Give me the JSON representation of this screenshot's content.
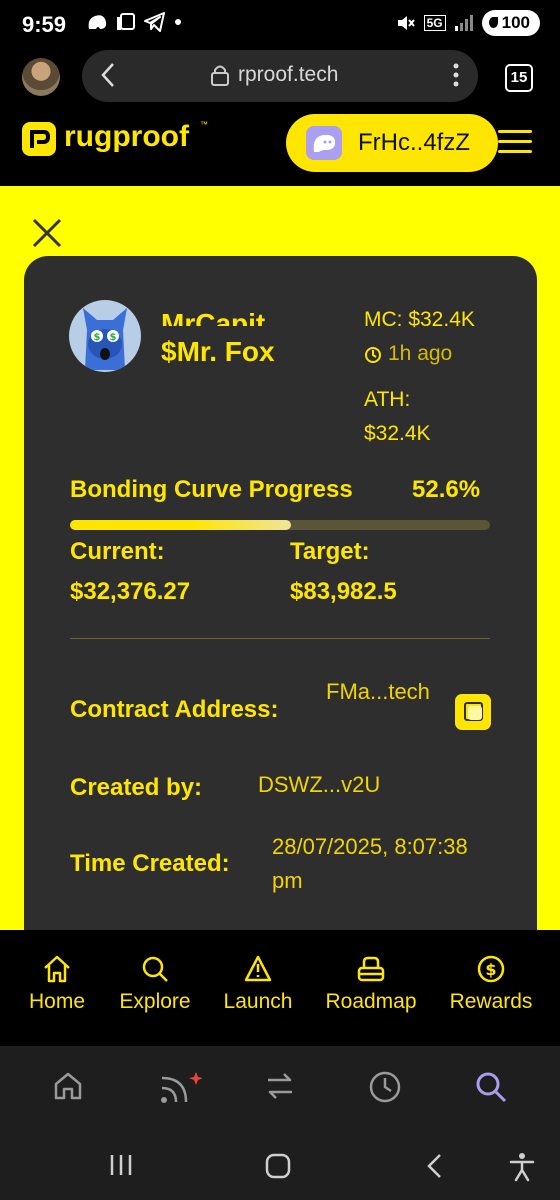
{
  "status_bar": {
    "time": "9:59",
    "network": "5G",
    "battery": "100"
  },
  "browser": {
    "url": "rproof.tech",
    "tab_count": "15"
  },
  "site_header": {
    "logo_text": "rugproof",
    "logo_tm": "™",
    "wallet_address": "FrHc..4fzZ"
  },
  "token": {
    "name": "MrCapit",
    "symbol": "$Mr. Fox",
    "market_cap": "MC: $32.4K",
    "created_ago": "1h ago",
    "ath_label": "ATH:",
    "ath_value": "$32.4K",
    "bonding_curve_label": "Bonding Curve Progress",
    "bonding_curve_percent": "52.6%",
    "bonding_curve_progress": 0.526,
    "current_label": "Current:",
    "current_value": "$32,376.27",
    "target_label": "Target:",
    "target_value": "$83,982.5",
    "contract_label": "Contract Address:",
    "contract_value": "FMa...tech",
    "created_by_label": "Created by:",
    "created_by_value": "DSWZ...v2U",
    "time_created_label": "Time Created:",
    "time_created_value": "28/07/2025, 8:07:38 pm"
  },
  "site_nav": {
    "items": [
      {
        "label": "Home",
        "icon": "home-icon"
      },
      {
        "label": "Explore",
        "icon": "search-icon"
      },
      {
        "label": "Launch",
        "icon": "rocket-icon"
      },
      {
        "label": "Roadmap",
        "icon": "roadmap-icon"
      },
      {
        "label": "Rewards",
        "icon": "dollar-icon"
      }
    ]
  },
  "colors": {
    "accent_yellow": "#ffe600",
    "card_bg": "#2e2e2e",
    "phantom_purple": "#ab9ff2",
    "active_tab_purple": "#a99ce8"
  }
}
